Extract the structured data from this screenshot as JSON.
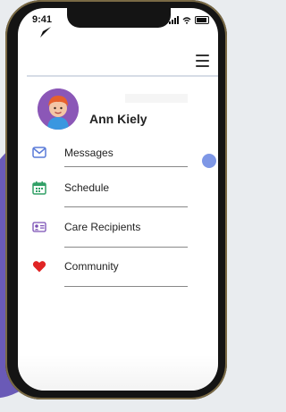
{
  "status": {
    "time": "9:41"
  },
  "user": {
    "name": "Ann Kiely",
    "avatar_color": "#8b57b7"
  },
  "menu": {
    "items": [
      {
        "label": "Messages",
        "icon": "messages-icon"
      },
      {
        "label": "Schedule",
        "icon": "calendar-icon",
        "color": "#32a067"
      },
      {
        "label": "Care Recipients",
        "icon": "id-card-icon",
        "color": "#7a4fb5"
      },
      {
        "label": "Community",
        "icon": "heart-icon",
        "color": "#e02424"
      }
    ]
  },
  "colors": {
    "accent": "#7e97e6",
    "frame": "#141414",
    "background_blob": "#6a5ab7"
  }
}
